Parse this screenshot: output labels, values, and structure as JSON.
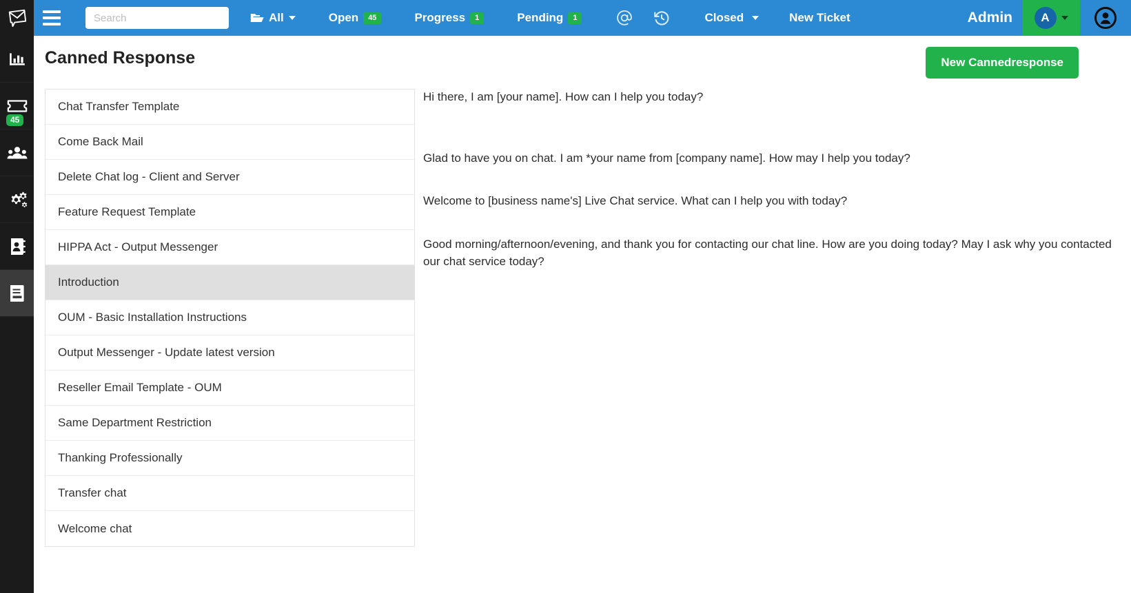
{
  "brand": {
    "logo_icon": "envelope-pin-logo"
  },
  "rail": {
    "items": [
      {
        "icon": "bar-chart-icon",
        "name": "dashboard",
        "active": false,
        "badge": null
      },
      {
        "icon": "ticket-icon",
        "name": "tickets",
        "active": false,
        "badge": "45"
      },
      {
        "icon": "users-icon",
        "name": "users",
        "active": false,
        "badge": null
      },
      {
        "icon": "gears-icon",
        "name": "settings",
        "active": false,
        "badge": null
      },
      {
        "icon": "address-book-icon",
        "name": "contacts",
        "active": false,
        "badge": null
      },
      {
        "icon": "book-icon",
        "name": "canned-response",
        "active": true,
        "badge": null
      }
    ]
  },
  "topnav": {
    "menu_icon": "hamburger-icon",
    "search": {
      "value": "",
      "placeholder": "Search"
    },
    "all": {
      "label": "All",
      "icon": "folder-open-icon"
    },
    "open": {
      "label": "Open",
      "count": "45"
    },
    "progress": {
      "label": "Progress",
      "count": "1"
    },
    "pending": {
      "label": "Pending",
      "count": "1"
    },
    "mention_icon": "at-icon",
    "history_icon": "history-icon",
    "closed": {
      "label": "Closed"
    },
    "new_ticket": {
      "label": "New Ticket"
    },
    "admin": {
      "label": "Admin",
      "avatar_initial": "A"
    },
    "profile_icon": "user-circle-icon"
  },
  "page": {
    "title": "Canned Response",
    "new_button": "New Cannedresponse"
  },
  "list": {
    "items": [
      {
        "label": "Chat Transfer Template",
        "selected": false
      },
      {
        "label": "Come Back Mail",
        "selected": false
      },
      {
        "label": "Delete Chat log - Client and Server",
        "selected": false
      },
      {
        "label": "Feature Request Template",
        "selected": false
      },
      {
        "label": "HIPPA Act - Output Messenger",
        "selected": false
      },
      {
        "label": "Introduction",
        "selected": true
      },
      {
        "label": "OUM - Basic Installation Instructions",
        "selected": false
      },
      {
        "label": "Output Messenger - Update latest version",
        "selected": false
      },
      {
        "label": "Reseller Email Template - OUM",
        "selected": false
      },
      {
        "label": "Same Department Restriction",
        "selected": false
      },
      {
        "label": "Thanking Professionally",
        "selected": false
      },
      {
        "label": "Transfer chat",
        "selected": false
      },
      {
        "label": "Welcome chat",
        "selected": false
      }
    ]
  },
  "content": {
    "paragraphs": [
      "Hi there, I am [your name]. How can I help you today?",
      "Glad to have you on chat. I am *your name from [company name]. How may I help you today?",
      "Welcome to [business name's] Live Chat service. What can I help you with today?",
      "Good morning/afternoon/evening, and thank you for contacting our chat line. How are you doing today? May I ask why you contacted our chat service today?"
    ]
  },
  "colors": {
    "header_blue": "#2b8ad3",
    "accent_green": "#22b24c",
    "rail_black": "#1b1b1b",
    "rail_active": "#3b3b3b",
    "row_selected": "#dfdfdf"
  }
}
